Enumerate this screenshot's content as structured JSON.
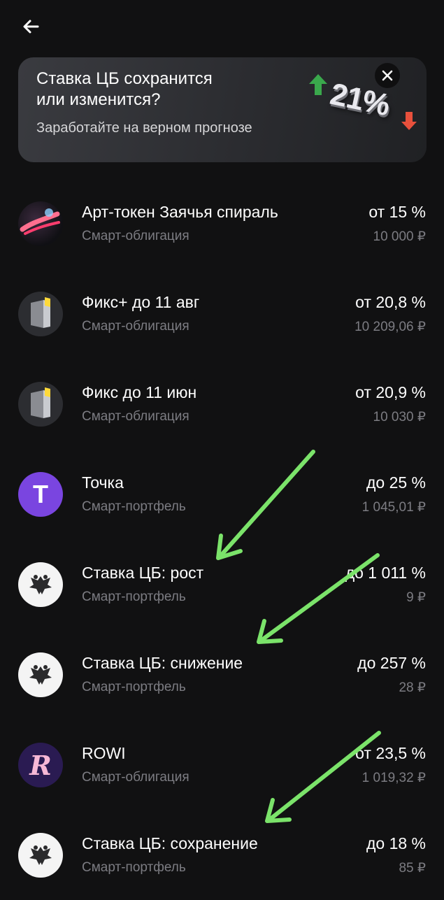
{
  "banner": {
    "title": "Ставка ЦБ сохранится\nили изменится?",
    "subtitle": "Заработайте на верном прогнозе",
    "percent": "21%"
  },
  "items": [
    {
      "name": "Арт-токен Заячья спираль",
      "type": "Смарт-облигация",
      "rate": "от 15 %",
      "price": "10 000 ₽",
      "icon": "art-token-icon"
    },
    {
      "name": "Фикс+ до 11 авг",
      "type": "Смарт-облигация",
      "rate": "от 20,8 %",
      "price": "10 209,06 ₽",
      "icon": "fix-bar-icon"
    },
    {
      "name": "Фикс до 11 июн",
      "type": "Смарт-облигация",
      "rate": "от 20,9 %",
      "price": "10 030 ₽",
      "icon": "fix-bar-icon"
    },
    {
      "name": "Точка",
      "type": "Смарт-портфель",
      "rate": "до 25 %",
      "price": "1 045,01 ₽",
      "icon": "tochka-logo-icon",
      "logo_letter": "T"
    },
    {
      "name": "Ставка ЦБ: рост",
      "type": "Смарт-портфель",
      "rate": "до 1 011 %",
      "price": "9 ₽",
      "icon": "double-eagle-icon"
    },
    {
      "name": "Ставка ЦБ: снижение",
      "type": "Смарт-портфель",
      "rate": "до 257 %",
      "price": "28 ₽",
      "icon": "double-eagle-icon"
    },
    {
      "name": "ROWI",
      "type": "Смарт-облигация",
      "rate": "от 23,5 %",
      "price": "1 019,32 ₽",
      "icon": "rowi-logo-icon",
      "logo_letter": "R"
    },
    {
      "name": "Ставка ЦБ: сохранение",
      "type": "Смарт-портфель",
      "rate": "до 18 %",
      "price": "85 ₽",
      "icon": "double-eagle-icon"
    }
  ],
  "colors": {
    "background": "#111112",
    "annotation_arrow": "#7be36a",
    "tochka": "#7a45e0",
    "rowi_bg": "#2a1b52",
    "rowi_letter": "#f6b8d6",
    "up_arrow": "#3aa84c",
    "down_arrow": "#e8503c"
  }
}
